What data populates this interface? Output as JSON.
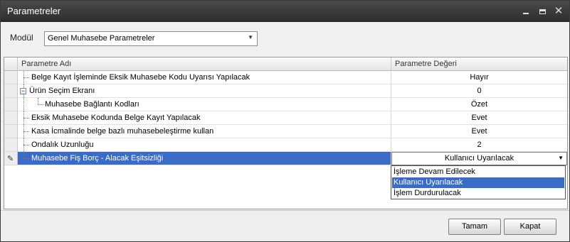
{
  "window": {
    "title": "Parametreler",
    "controls": {
      "minimize": "minimize-icon",
      "maximize": "maximize-icon",
      "close": "close-icon"
    }
  },
  "module": {
    "label": "Modül",
    "selected": "Genel Muhasebe Parametreler"
  },
  "grid": {
    "columns": {
      "name": "Parametre Adı",
      "value": "Parametre Değeri"
    },
    "rows": [
      {
        "name": "Belge Kayıt İşleminde Eksik Muhasebe Kodu Uyarısı Yapılacak",
        "value": "Hayır"
      },
      {
        "name": "Ürün Seçim Ekranı",
        "value": "0",
        "expanded": true
      },
      {
        "name": "Muhasebe Bağlantı Kodları",
        "value": "Özet",
        "child": true
      },
      {
        "name": "Eksik Muhasebe Kodunda Belge Kayıt Yapılacak",
        "value": "Evet"
      },
      {
        "name": "Kasa İcmalinde belge bazlı muhasebeleştirme kullan",
        "value": "Evet"
      },
      {
        "name": "Ondalık Uzunluğu",
        "value": "2"
      },
      {
        "name": "Muhasebe Fiş Borç - Alacak Eşitsizliği",
        "value": "Kullanıcı Uyarılacak",
        "selected": true,
        "editing": true
      }
    ]
  },
  "dropdown": {
    "options": [
      "İşleme Devam Edilecek",
      "Kullanıcı Uyarılacak",
      "İşlem Durdurulacak"
    ],
    "highlighted": "Kullanıcı Uyarılacak"
  },
  "footer": {
    "ok_label": "Tamam",
    "close_label": "Kapat"
  },
  "colors": {
    "title_bar": "#2c2c2c",
    "selection": "#3a6bc6"
  }
}
